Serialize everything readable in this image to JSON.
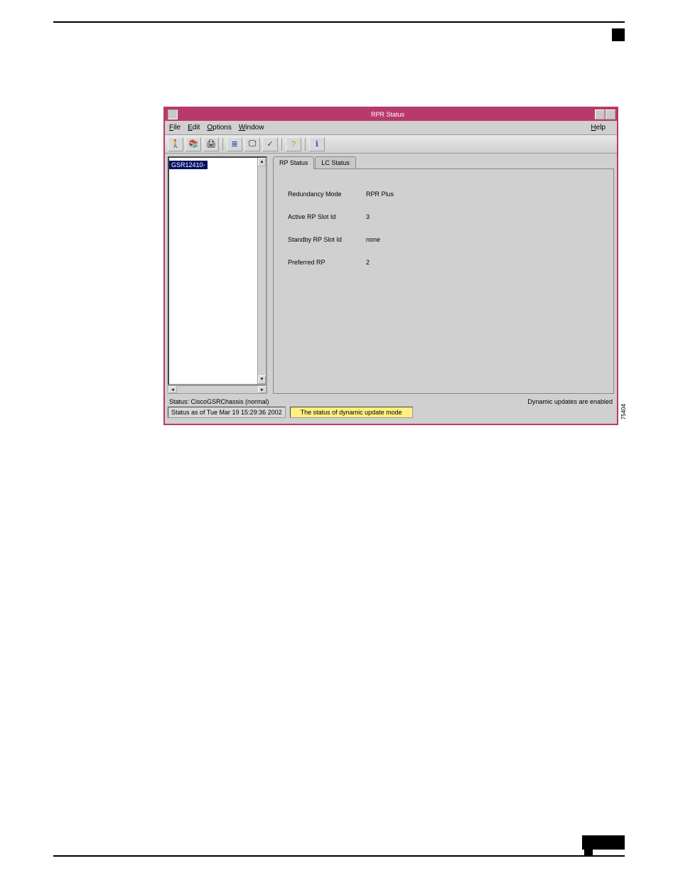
{
  "window": {
    "title": "RPR Status"
  },
  "menubar": {
    "file": "File",
    "edit": "Edit",
    "options": "Options",
    "window": "Window",
    "help": "Help"
  },
  "toolbar_icons": {
    "i1": "🚶",
    "i2": "📚",
    "i3": "🖨",
    "i4": "≣",
    "i5": "🖵",
    "i6": "✓",
    "i7": "?",
    "i8": "ℹ"
  },
  "tree": {
    "item1": "GSR12410-"
  },
  "tabs": {
    "rp_status": "RP Status",
    "lc_status": "LC Status"
  },
  "fields": {
    "redundancy_mode": {
      "label": "Redundancy Mode",
      "value": "RPR Plus"
    },
    "active_rp": {
      "label": "Active RP Slot Id",
      "value": "3"
    },
    "standby_rp": {
      "label": "Standby RP Slot Id",
      "value": "none"
    },
    "preferred_rp": {
      "label": "Preferred RP",
      "value": "2"
    }
  },
  "status": {
    "chassis": "Status: CiscoGSRChassis (normal)",
    "dynamic": "Dynamic updates are enabled",
    "timestamp": "Status as of Tue Mar 19 15:29:36 2002",
    "tooltip": "The status of dynamic update mode"
  },
  "figure_id": "75404"
}
